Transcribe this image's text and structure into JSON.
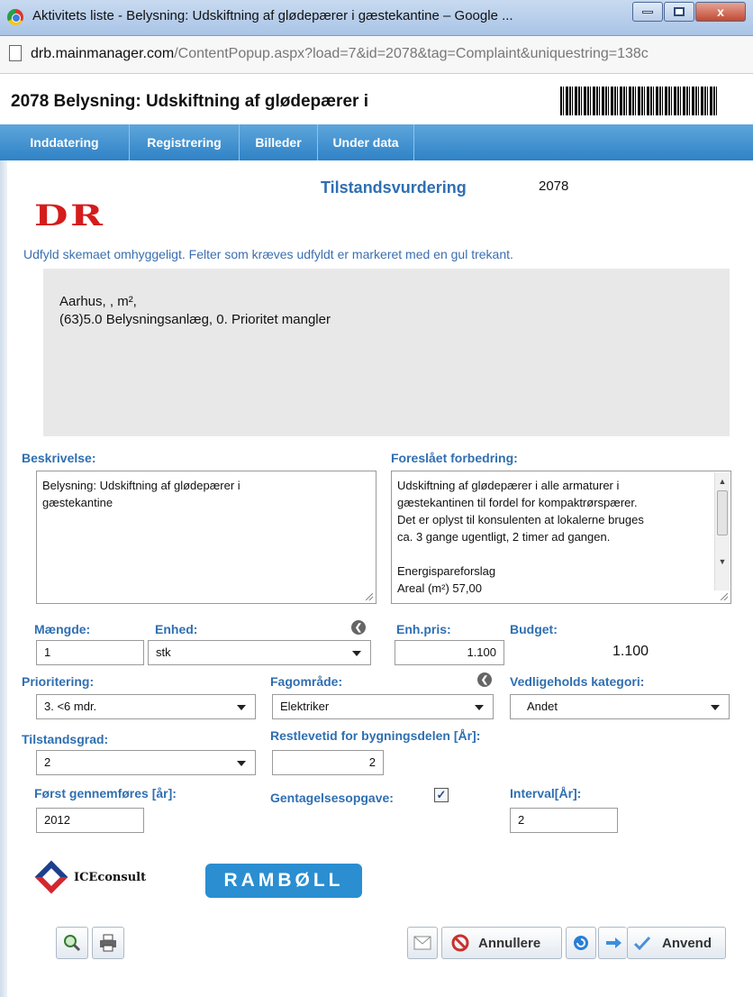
{
  "window": {
    "title": "Aktivitets liste - Belysning: Udskiftning af glødepærer i gæstekantine – Google ...",
    "url_host": "drb.mainmanager.com",
    "url_path": "/ContentPopup.aspx?load=7&id=2078&tag=Complaint&uniquestring=138c",
    "close_glyph": "x"
  },
  "header": {
    "record_title": "2078 Belysning: Udskiftning af glødepærer i"
  },
  "tabs": [
    {
      "label": "Inddatering"
    },
    {
      "label": "Registrering"
    },
    {
      "label": "Billeder"
    },
    {
      "label": "Under data"
    }
  ],
  "form": {
    "logo_text": "DR",
    "title": "Tilstandsvurdering",
    "id": "2078",
    "instruction": "Udfyld skemaet omhyggeligt. Felter som kræves udfyldt er markeret med en gul trekant.",
    "info_line1": "Aarhus, , m²,",
    "info_line2": "(63)5.0 Belysningsanlæg, 0. Prioritet mangler"
  },
  "beskrivelse": {
    "label": "Beskrivelse:",
    "value": "Belysning: Udskiftning af glødepærer i gæstekantine"
  },
  "forbedring": {
    "label": "Foreslået forbedring:",
    "line1": "Udskiftning af glødepærer i alle armaturer i",
    "line2": "gæstekantinen til fordel for kompaktrørspærer.",
    "line3": "Det er oplyst til konsulenten at lokalerne bruges",
    "line4": "ca. 3 gange ugentligt, 2 timer ad gangen.",
    "line5": "Energispareforslag",
    "line6": "Areal (m²) 57,00"
  },
  "fields": {
    "maengde_label": "Mængde:",
    "maengde_value": "1",
    "enhed_label": "Enhed:",
    "enhed_value": "stk",
    "enhpris_label": "Enh.pris:",
    "enhpris_value": "1.100",
    "budget_label": "Budget:",
    "budget_value": "1.100",
    "prioritering_label": "Prioritering:",
    "prioritering_value": "3. <6 mdr.",
    "fagomraade_label": "Fagområde:",
    "fagomraade_value": "Elektriker",
    "vedligehold_label": "Vedligeholds kategori:",
    "vedligehold_value": "Andet",
    "tilstandsgrad_label": "Tilstandsgrad:",
    "tilstandsgrad_value": "2",
    "restlevetid_label": "Restlevetid for bygningsdelen [År]:",
    "restlevetid_value": "2",
    "foerst_label": "Først gennemføres [år]:",
    "foerst_value": "2012",
    "gentagelse_label": "Gentagelsesopgave:",
    "gentagelse_checked": true,
    "gentagelse_check_glyph": "✓",
    "interval_label": "Interval[År]:",
    "interval_value": "2",
    "info_glyph": "❮"
  },
  "logos": {
    "iceconsult": "ICEconsult",
    "ramboll": "RAMBØLL"
  },
  "buttons": {
    "annullere": "Annullere",
    "anvend": "Anvend"
  },
  "icons": [
    "zoom-icon",
    "print-icon",
    "mail-icon",
    "cancel-icon",
    "refresh-icon",
    "forward-icon",
    "checkmark-icon"
  ],
  "colors": {
    "tab_bar": "#3a8fd0",
    "label_blue": "#2f6fb1",
    "ramboll_blue": "#2a8ed1",
    "dr_red": "#d41c1c"
  }
}
